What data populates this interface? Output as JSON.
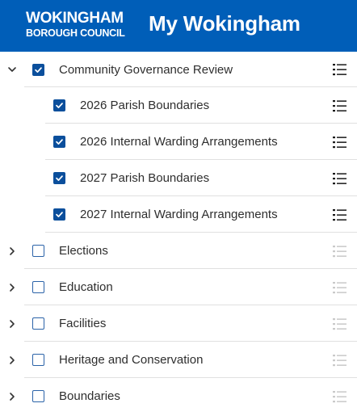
{
  "header": {
    "logo_line1": "WOKINGHAM",
    "logo_line2": "BOROUGH COUNCIL",
    "title": "My Wokingham",
    "bg_color": "#005eb8"
  },
  "layers": [
    {
      "label": "Community Governance Review",
      "expanded": true,
      "checked": true,
      "icon_caret": "chevron-down-icon",
      "icon_options": "layer-options-icon",
      "children": [
        {
          "label": "2026 Parish Boundaries",
          "checked": true,
          "icon_options": "layer-options-icon"
        },
        {
          "label": "2026 Internal Warding Arrangements",
          "checked": true,
          "icon_options": "layer-options-icon"
        },
        {
          "label": "2027 Parish Boundaries",
          "checked": true,
          "icon_options": "layer-options-icon"
        },
        {
          "label": "2027 Internal Warding Arrangements",
          "checked": true,
          "icon_options": "layer-options-icon"
        }
      ]
    },
    {
      "label": "Elections",
      "expanded": false,
      "checked": false,
      "icon_caret": "chevron-right-icon",
      "icon_options": "layer-options-icon"
    },
    {
      "label": "Education",
      "expanded": false,
      "checked": false,
      "icon_caret": "chevron-right-icon",
      "icon_options": "layer-options-icon"
    },
    {
      "label": "Facilities",
      "expanded": false,
      "checked": false,
      "icon_caret": "chevron-right-icon",
      "icon_options": "layer-options-icon"
    },
    {
      "label": "Heritage and Conservation",
      "expanded": false,
      "checked": false,
      "icon_caret": "chevron-right-icon",
      "icon_options": "layer-options-icon"
    },
    {
      "label": "Boundaries",
      "expanded": false,
      "checked": false,
      "icon_caret": "chevron-right-icon",
      "icon_options": "layer-options-icon"
    }
  ],
  "colors": {
    "checkbox_checked": "#0b4f9c",
    "checkbox_border": "#2b63a8",
    "options_active": "#1a1a1a",
    "options_inactive": "#c9c9c9"
  }
}
